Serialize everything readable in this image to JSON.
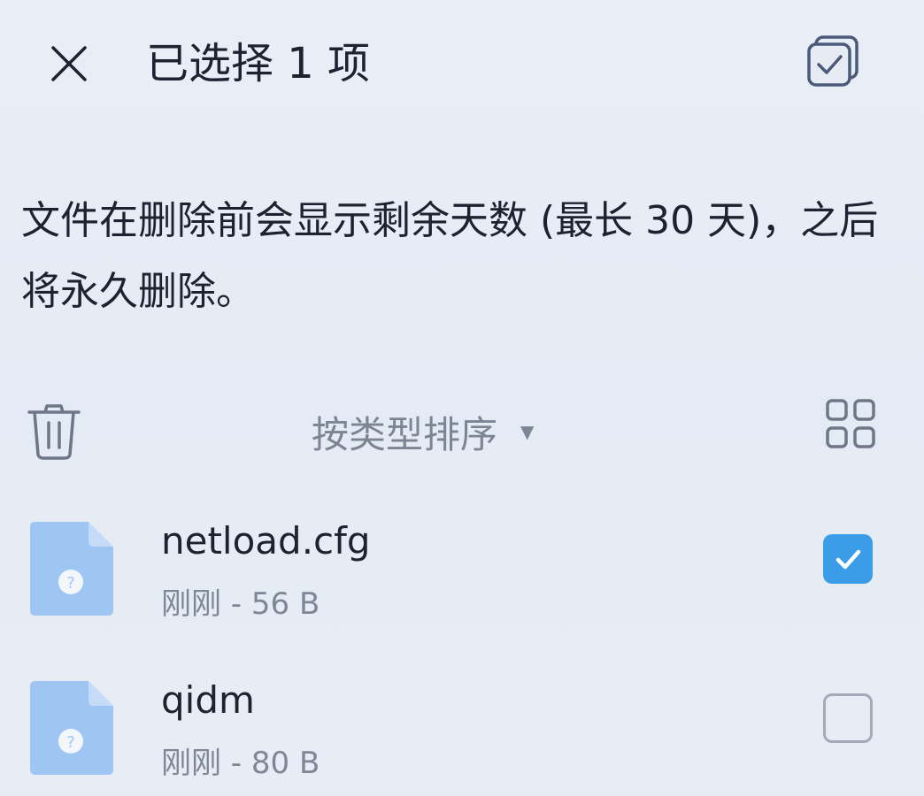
{
  "header": {
    "title": "已选择 1 项",
    "close_icon": "close-icon",
    "select_all_icon": "select-all-icon"
  },
  "notice": {
    "text": "文件在删除前会显示剩余天数 (最长 30 天)，之后将永久删除。"
  },
  "toolbar": {
    "delete_icon": "trash-icon",
    "sort_label": "按类型排序",
    "sort_caret_icon": "caret-down-icon",
    "view_icon": "grid-view-icon"
  },
  "files": [
    {
      "name": "netload.cfg",
      "meta": "刚刚 - 56 B",
      "checked": true,
      "icon": "unknown-file-icon"
    },
    {
      "name": "qidm",
      "meta": "刚刚 - 80 B",
      "checked": false,
      "icon": "unknown-file-icon"
    }
  ],
  "colors": {
    "background": "#e6ecf4",
    "accent": "#3b9ce8",
    "file_icon": "#9fc6f2",
    "text_primary": "#1c2230",
    "text_secondary": "#7f8796"
  }
}
